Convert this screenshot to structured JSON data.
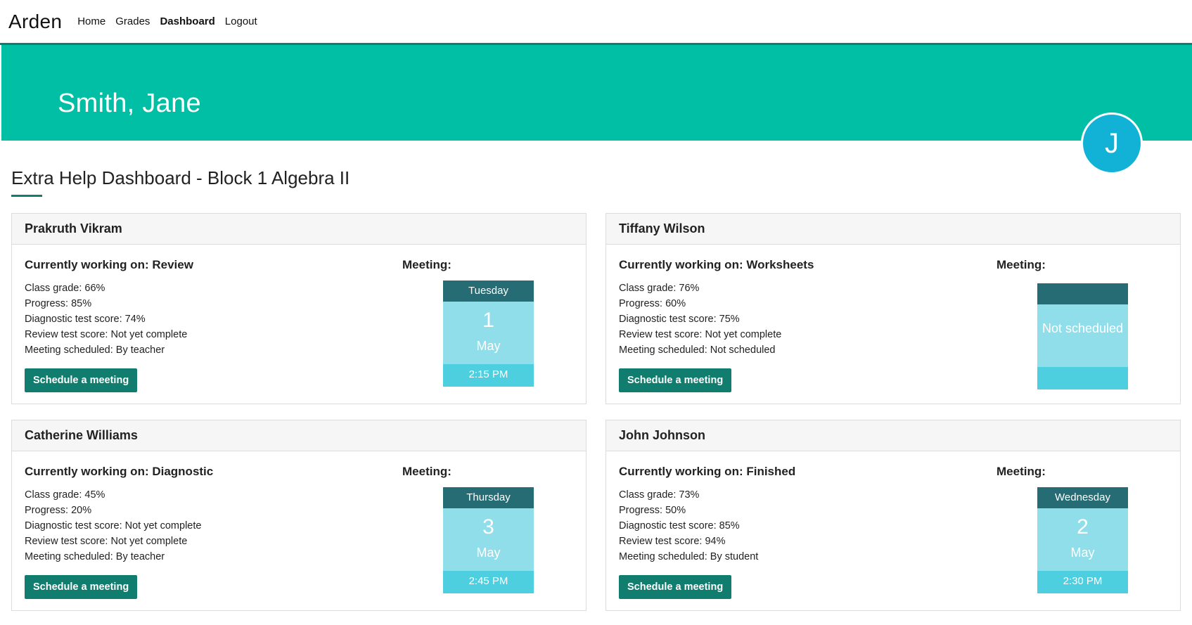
{
  "nav": {
    "brand": "Arden",
    "links": [
      "Home",
      "Grades",
      "Dashboard",
      "Logout"
    ]
  },
  "hero": {
    "name": "Smith, Jane",
    "avatar_initial": "J"
  },
  "dashboard": {
    "title": "Extra Help Dashboard - Block 1 Algebra II"
  },
  "meeting_label": "Meeting:",
  "button_label": "Schedule a meeting",
  "students": [
    {
      "name": "Prakruth Vikram",
      "working_on": "Currently working on: Review",
      "stats": [
        "Class grade: 66%",
        "Progress: 85%",
        "Diagnostic test score: 74%",
        "Review test score: Not yet complete",
        "Meeting scheduled: By teacher"
      ],
      "meeting": {
        "day": "Tuesday",
        "date": "1",
        "month": "May",
        "time": "2:15 PM"
      }
    },
    {
      "name": "Tiffany Wilson",
      "working_on": "Currently working on: Worksheets",
      "stats": [
        "Class grade: 76%",
        "Progress: 60%",
        "Diagnostic test score: 75%",
        "Review test score: Not yet complete",
        "Meeting scheduled: Not scheduled"
      ],
      "meeting": {
        "day": "",
        "status": "Not scheduled",
        "time": ""
      }
    },
    {
      "name": "Catherine Williams",
      "working_on": "Currently working on: Diagnostic",
      "stats": [
        "Class grade: 45%",
        "Progress: 20%",
        "Diagnostic test score: Not yet complete",
        "Review test score: Not yet complete",
        "Meeting scheduled: By teacher"
      ],
      "meeting": {
        "day": "Thursday",
        "date": "3",
        "month": "May",
        "time": "2:45 PM"
      }
    },
    {
      "name": "John Johnson",
      "working_on": "Currently working on: Finished",
      "stats": [
        "Class grade: 73%",
        "Progress: 50%",
        "Diagnostic test score: 85%",
        "Review test score: 94%",
        "Meeting scheduled: By student"
      ],
      "meeting": {
        "day": "Wednesday",
        "date": "2",
        "month": "May",
        "time": "2:30 PM"
      }
    }
  ]
}
